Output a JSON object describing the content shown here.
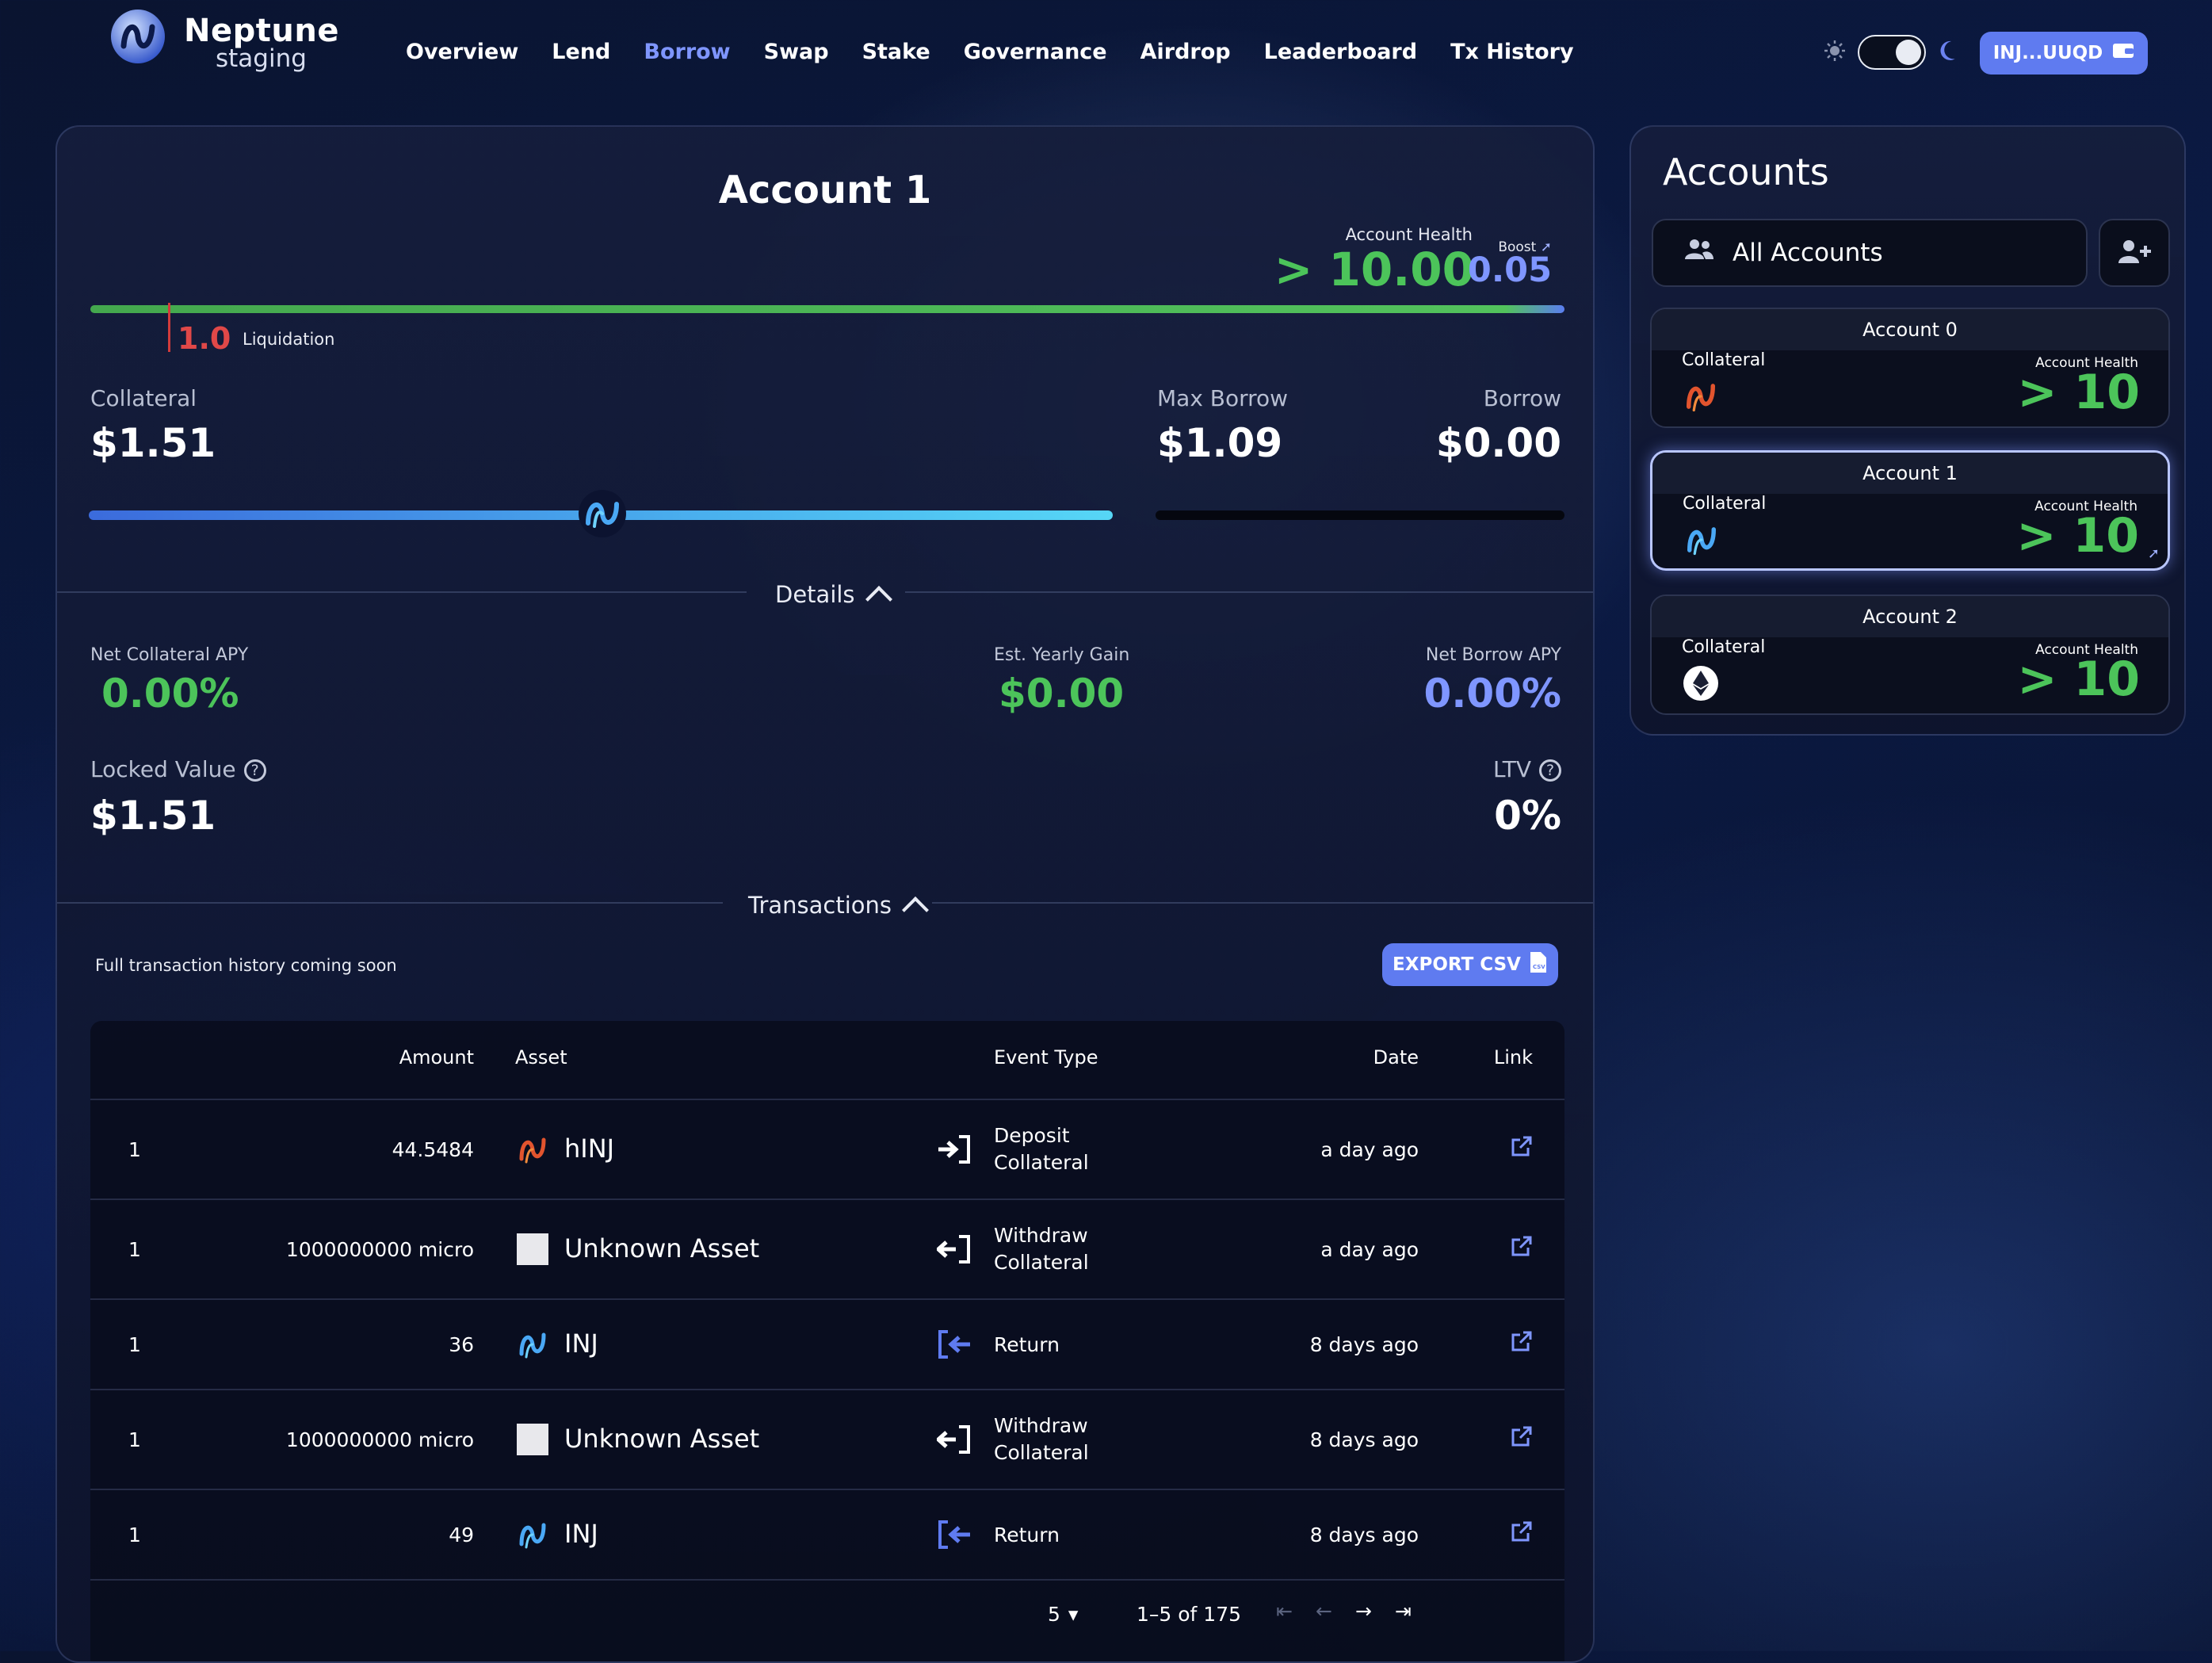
{
  "app": {
    "name": "Neptune",
    "env": "staging"
  },
  "nav": [
    "Overview",
    "Lend",
    "Borrow",
    "Swap",
    "Stake",
    "Governance",
    "Airdrop",
    "Leaderboard",
    "Tx History"
  ],
  "nav_active": "Borrow",
  "wallet": {
    "label": "INJ...UUQD"
  },
  "account": {
    "title": "Account 1",
    "health_label": "Account Health",
    "health_value": "> 10.00",
    "boost_label": "Boost",
    "boost_value": "0.05",
    "liquidation_value": "1.0",
    "liquidation_label": "Liquidation",
    "collateral_label": "Collateral",
    "collateral_value": "$1.51",
    "max_borrow_label": "Max Borrow",
    "max_borrow_value": "$1.09",
    "borrow_label": "Borrow",
    "borrow_value": "$0.00",
    "collateral_slider_fraction": 0.5
  },
  "details": {
    "header": "Details",
    "net_collateral_apy_label": "Net Collateral APY",
    "net_collateral_apy": "0.00%",
    "est_yearly_gain_label": "Est. Yearly Gain",
    "est_yearly_gain": "$0.00",
    "net_borrow_apy_label": "Net Borrow APY",
    "net_borrow_apy": "0.00%",
    "locked_value_label": "Locked Value",
    "locked_value": "$1.51",
    "ltv_label": "LTV",
    "ltv_value": "0%"
  },
  "transactions": {
    "header": "Transactions",
    "note": "Full transaction history coming soon",
    "export_label": "EXPORT CSV",
    "columns": [
      "Amount",
      "Asset",
      "Event Type",
      "Date",
      "Link"
    ],
    "rows": [
      {
        "index": "1",
        "amount": "44.5484",
        "asset": "hINJ",
        "asset_icon": "hinj-icon",
        "event": [
          "Deposit",
          "Collateral"
        ],
        "event_icon": "deposit-icon",
        "date": "a day ago"
      },
      {
        "index": "1",
        "amount": "1000000000 micro",
        "asset": "Unknown Asset",
        "asset_icon": "unknown-asset-icon",
        "event": [
          "Withdraw",
          "Collateral"
        ],
        "event_icon": "withdraw-icon",
        "date": "a day ago"
      },
      {
        "index": "1",
        "amount": "36",
        "asset": "INJ",
        "asset_icon": "inj-icon",
        "event": [
          "Return"
        ],
        "event_icon": "return-icon",
        "date": "8 days ago"
      },
      {
        "index": "1",
        "amount": "1000000000 micro",
        "asset": "Unknown Asset",
        "asset_icon": "unknown-asset-icon",
        "event": [
          "Withdraw",
          "Collateral"
        ],
        "event_icon": "withdraw-icon",
        "date": "8 days ago"
      },
      {
        "index": "1",
        "amount": "49",
        "asset": "INJ",
        "asset_icon": "inj-icon",
        "event": [
          "Return"
        ],
        "event_icon": "return-icon",
        "date": "8 days ago"
      }
    ],
    "pagination": {
      "page_size": "5",
      "range": "1–5 of 175"
    }
  },
  "accounts_panel": {
    "title": "Accounts",
    "all_accounts_label": "All Accounts",
    "items": [
      {
        "name": "Account 0",
        "collateral_label": "Collateral",
        "health_label": "Account Health",
        "health_value": "> 10",
        "collateral_icon": "hinj-icon",
        "selected": false
      },
      {
        "name": "Account 1",
        "collateral_label": "Collateral",
        "health_label": "Account Health",
        "health_value": "> 10",
        "collateral_icon": "inj-icon",
        "selected": true
      },
      {
        "name": "Account 2",
        "collateral_label": "Collateral",
        "health_label": "Account Health",
        "health_value": "> 10",
        "collateral_icon": "eth-icon",
        "selected": false
      }
    ]
  },
  "colors": {
    "accent": "#7f96ff",
    "green": "#4cc45a",
    "liquidation": "#e04848",
    "button": "#5f7bf0"
  }
}
